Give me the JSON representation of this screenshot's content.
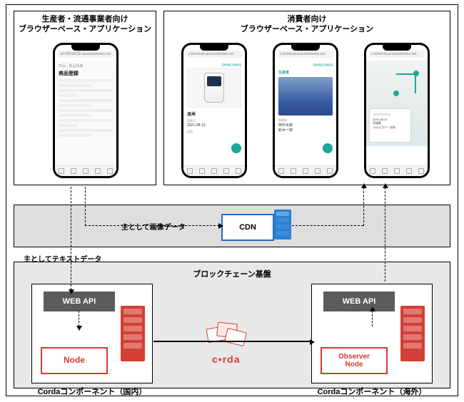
{
  "producer": {
    "title_line1": "生産者・流通事業者向け",
    "title_line2": "ブラウザーベース・アプリケーション",
    "phone_url": "rel-08516030.azurewebsites.net",
    "form_breadcrumb": "商品 › 製品情報",
    "form_title": "商品登録"
  },
  "consumer": {
    "title_line1": "消費者向け",
    "title_line2": "ブラウザーベース・アプリケーション",
    "phone_url": "c-terminal.azurewebsites.net",
    "brand": "SHINCHAIN",
    "phone1": {
      "product_name": "淡米",
      "field_date_label": "登録日",
      "field_date_value": "2021-08-19",
      "field_place_label": "出荷"
    },
    "phone2": {
      "section": "生産者",
      "role": "管理者",
      "name1": "田中太郎",
      "name2": "鈴木一郎"
    },
    "phone3": {
      "card_date": "2021-08-12",
      "card_place": "茨城県",
      "card_item": "コシヒカリ・淡米"
    }
  },
  "cdn": {
    "label": "主として画像データ",
    "box": "CDN"
  },
  "blockchain": {
    "text_data_label": "主としてテキストデータ",
    "base_title": "ブロックチェーン基盤",
    "webapi": "WEB API",
    "node": "Node",
    "observer_node_l1": "Observer",
    "observer_node_l2": "Node",
    "domestic_caption": "Cordaコンポーネント（国内）",
    "overseas_caption": "Cordaコンポーネント（海外）",
    "corda_logo": "c•rda"
  }
}
